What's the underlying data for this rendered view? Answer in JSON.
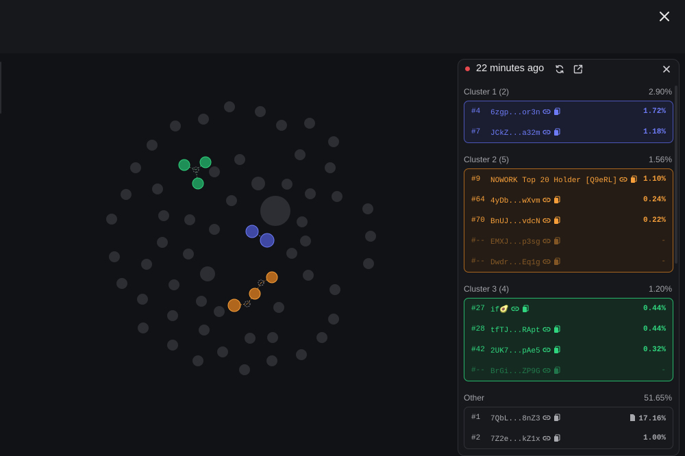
{
  "colors": {
    "cluster1": "#6d7cf6",
    "cluster2": "#f59e3a",
    "cluster3": "#30d67f",
    "neutral": "#3a3c42",
    "live": "#e5484d"
  },
  "panel": {
    "title": "22 minutes ago",
    "icons": {
      "live": "live-dot",
      "refresh": "refresh-icon",
      "external": "external-link-icon",
      "close": "close-icon"
    }
  },
  "clusters": [
    {
      "label": "Cluster 1 (2)",
      "pct": "2.90%",
      "rows": [
        {
          "rank": "#4",
          "addr": "6zgp...or3n",
          "pct": "1.72%"
        },
        {
          "rank": "#7",
          "addr": "JCkZ...a32m",
          "pct": "1.18%"
        }
      ]
    },
    {
      "label": "Cluster 2 (5)",
      "pct": "1.56%",
      "rows": [
        {
          "rank": "#9",
          "addr": "NOWORK Top 20 Holder [Q9eRL]",
          "pct": "1.10%"
        },
        {
          "rank": "#64",
          "addr": "4yDb...wXvm",
          "pct": "0.24%"
        },
        {
          "rank": "#70",
          "addr": "BnUJ...vdcN",
          "pct": "0.22%"
        },
        {
          "rank": "#--",
          "addr": "EMXJ...p3sg",
          "pct": "-"
        },
        {
          "rank": "#--",
          "addr": "Dwdr...Eq1g",
          "pct": "-"
        }
      ]
    },
    {
      "label": "Cluster 3 (4)",
      "pct": "1.20%",
      "rows": [
        {
          "rank": "#27",
          "addr": "if🥑",
          "pct": "0.44%"
        },
        {
          "rank": "#28",
          "addr": "tfTJ...RApt",
          "pct": "0.44%"
        },
        {
          "rank": "#42",
          "addr": "2UK7...pAe5",
          "pct": "0.32%"
        },
        {
          "rank": "#--",
          "addr": "BrGi...ZP9G",
          "pct": "-"
        }
      ]
    },
    {
      "label": "Other",
      "pct": "51.65%",
      "rows": [
        {
          "rank": "#1",
          "addr": "7QbL...8nZ3",
          "pct": "17.16%"
        },
        {
          "rank": "#2",
          "addr": "7Z2e...kZ1x",
          "pct": "1.00%"
        }
      ]
    }
  ]
}
